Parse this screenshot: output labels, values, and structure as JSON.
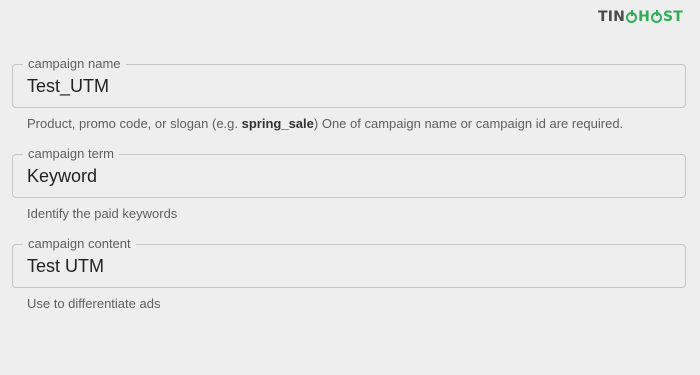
{
  "brand": {
    "part1": "TIN",
    "part2": "H",
    "part3": "ST",
    "accent_color": "#2fae59"
  },
  "fields": [
    {
      "label": "campaign name",
      "value": "Test_UTM",
      "helper_pre": "Product, promo code, or slogan (e.g. ",
      "helper_bold": "spring_sale",
      "helper_post": ") One of campaign name or campaign id are required."
    },
    {
      "label": "campaign term",
      "value": "Keyword",
      "helper": "Identify the paid keywords"
    },
    {
      "label": "campaign content",
      "value": "Test UTM",
      "helper": "Use to differentiate ads"
    }
  ]
}
